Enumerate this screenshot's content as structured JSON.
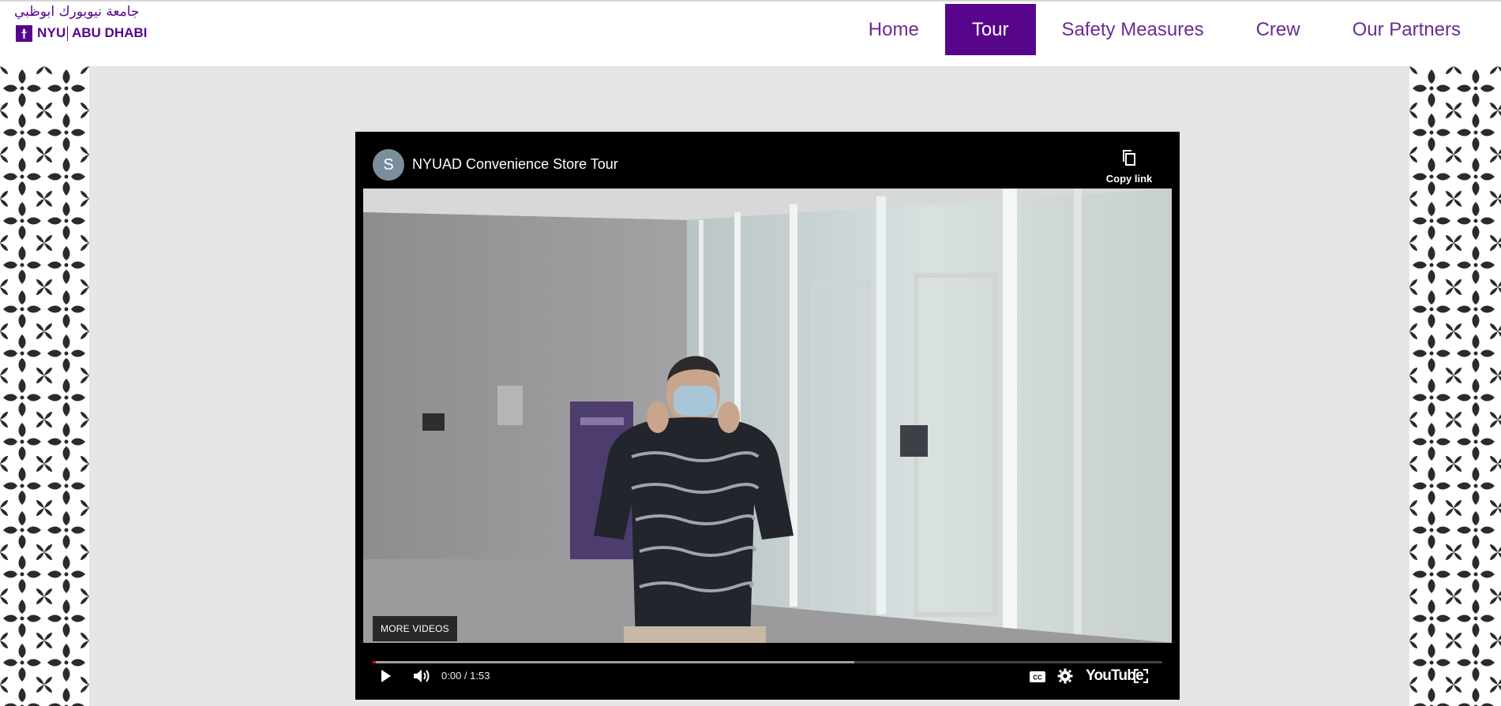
{
  "logo": {
    "arabic": "جامعة نيويورك ابوظبي",
    "nyu": "NYU",
    "campus": "ABU DHABI"
  },
  "nav": {
    "items": [
      {
        "label": "Home",
        "active": false
      },
      {
        "label": "Tour",
        "active": true
      },
      {
        "label": "Safety Measures",
        "active": false
      },
      {
        "label": "Crew",
        "active": false
      },
      {
        "label": "Our Partners",
        "active": false
      }
    ]
  },
  "video": {
    "channel_initial": "S",
    "title": "NYUAD Convenience Store Tour",
    "copy_link_label": "Copy link",
    "more_videos_label": "MORE VIDEOS",
    "time_display": "0:00 / 1:53",
    "buffered_fraction": 0.61,
    "played_fraction": 0.0,
    "youtube_label": "YouTube",
    "icons": [
      "copy-icon",
      "play-icon",
      "volume-icon",
      "captions-icon",
      "settings-icon",
      "fullscreen-icon"
    ]
  },
  "colors": {
    "brand_purple": "#57068c",
    "nav_text": "#6a2c91",
    "page_bg": "#e6e6e6",
    "progress_red": "#ff0000"
  }
}
